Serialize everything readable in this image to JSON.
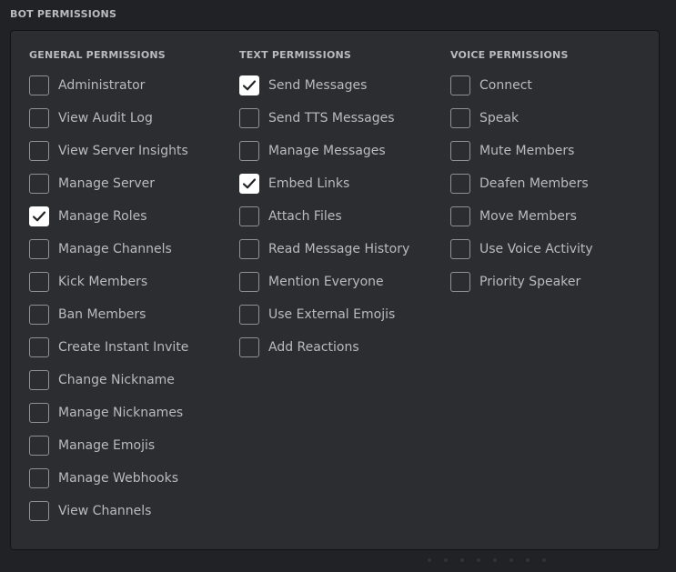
{
  "section": {
    "title": "BOT PERMISSIONS"
  },
  "columns": [
    {
      "title": "GENERAL PERMISSIONS",
      "items": [
        {
          "label": "Administrator",
          "checked": false
        },
        {
          "label": "View Audit Log",
          "checked": false
        },
        {
          "label": "View Server Insights",
          "checked": false
        },
        {
          "label": "Manage Server",
          "checked": false
        },
        {
          "label": "Manage Roles",
          "checked": true
        },
        {
          "label": "Manage Channels",
          "checked": false
        },
        {
          "label": "Kick Members",
          "checked": false
        },
        {
          "label": "Ban Members",
          "checked": false
        },
        {
          "label": "Create Instant Invite",
          "checked": false
        },
        {
          "label": "Change Nickname",
          "checked": false
        },
        {
          "label": "Manage Nicknames",
          "checked": false
        },
        {
          "label": "Manage Emojis",
          "checked": false
        },
        {
          "label": "Manage Webhooks",
          "checked": false
        },
        {
          "label": "View Channels",
          "checked": false
        }
      ]
    },
    {
      "title": "TEXT PERMISSIONS",
      "items": [
        {
          "label": "Send Messages",
          "checked": true
        },
        {
          "label": "Send TTS Messages",
          "checked": false
        },
        {
          "label": "Manage Messages",
          "checked": false
        },
        {
          "label": "Embed Links",
          "checked": true
        },
        {
          "label": "Attach Files",
          "checked": false
        },
        {
          "label": "Read Message History",
          "checked": false
        },
        {
          "label": "Mention Everyone",
          "checked": false
        },
        {
          "label": "Use External Emojis",
          "checked": false
        },
        {
          "label": "Add Reactions",
          "checked": false
        }
      ]
    },
    {
      "title": "VOICE PERMISSIONS",
      "items": [
        {
          "label": "Connect",
          "checked": false
        },
        {
          "label": "Speak",
          "checked": false
        },
        {
          "label": "Mute Members",
          "checked": false
        },
        {
          "label": "Deafen Members",
          "checked": false
        },
        {
          "label": "Move Members",
          "checked": false
        },
        {
          "label": "Use Voice Activity",
          "checked": false
        },
        {
          "label": "Priority Speaker",
          "checked": false
        }
      ]
    }
  ],
  "icons": {
    "check": "checkmark-icon"
  },
  "colors": {
    "background": "#202225",
    "panel": "#2b2d31",
    "text": "#b9bbbe",
    "checkbox_border": "#8e9297",
    "checked_fill": "#ffffff",
    "check_mark": "#202225"
  }
}
